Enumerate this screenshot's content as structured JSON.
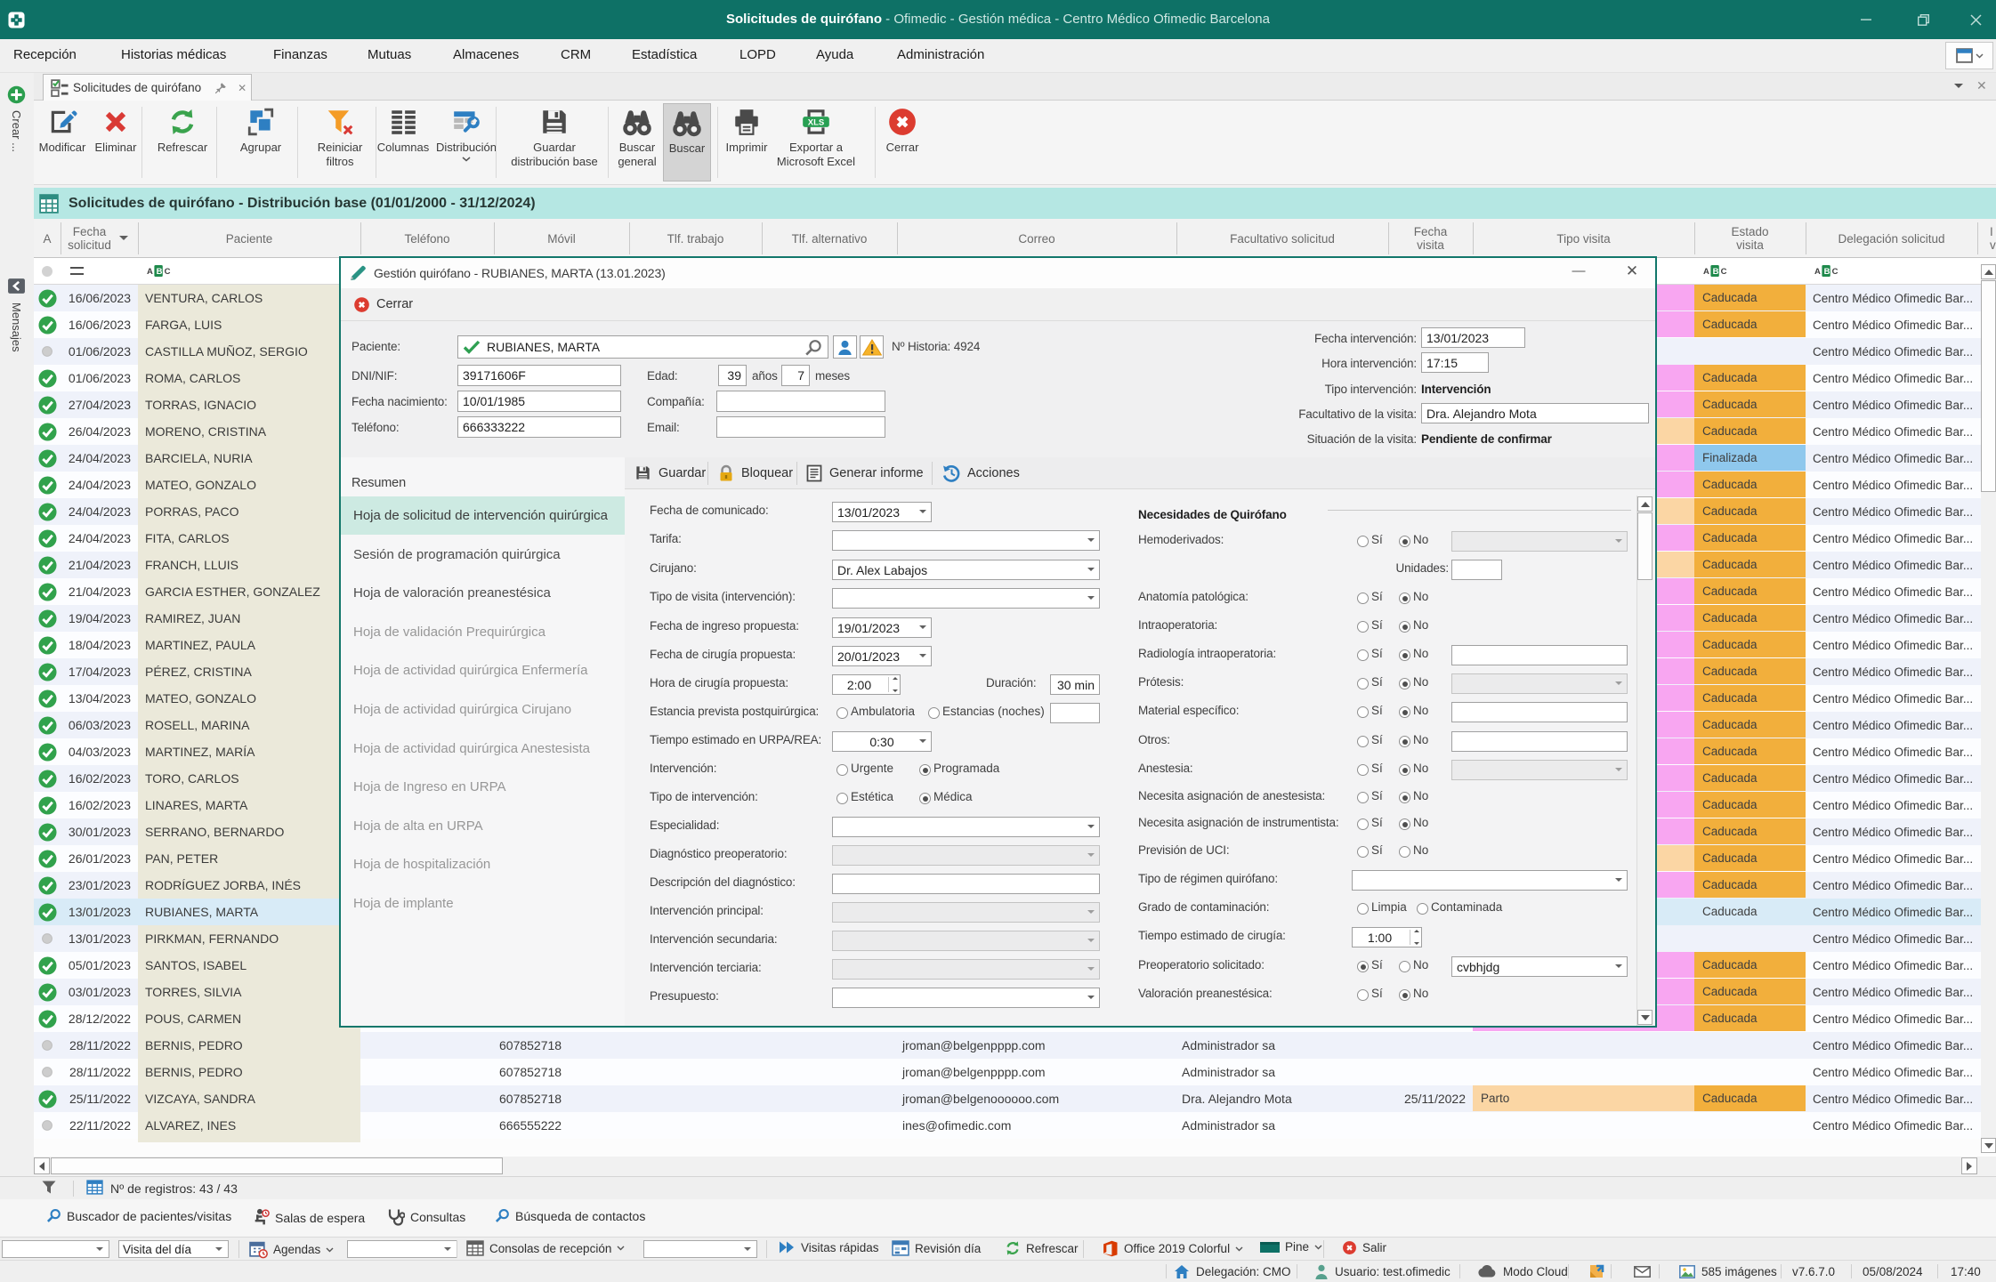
{
  "window": {
    "title": "Solicitudes de quirófano",
    "title_suffix": " - Ofimedic - Gestión médica - Centro Médico Ofimedic Barcelona"
  },
  "menu": {
    "items": [
      "Recepción",
      "Historias médicas",
      "Finanzas",
      "Mutuas",
      "Almacenes",
      "CRM",
      "Estadística",
      "LOPD",
      "Ayuda",
      "Administración"
    ]
  },
  "tab": {
    "label": "Solicitudes de quirófano"
  },
  "toolbar": {
    "buttons": [
      {
        "label1": "Modificar",
        "label2": ""
      },
      {
        "label1": "Eliminar",
        "label2": ""
      },
      {
        "label1": "Refrescar",
        "label2": ""
      },
      {
        "label1": "Agrupar",
        "label2": ""
      },
      {
        "label1": "Reiniciar",
        "label2": "filtros"
      },
      {
        "label1": "Columnas",
        "label2": ""
      },
      {
        "label1": "Distribución",
        "label2": ""
      },
      {
        "label1": "Guardar",
        "label2": "distribución base"
      },
      {
        "label1": "Buscar",
        "label2": "general"
      },
      {
        "label1": "Buscar",
        "label2": ""
      },
      {
        "label1": "Imprimir",
        "label2": ""
      },
      {
        "label1": "Exportar a",
        "label2": "Microsoft Excel"
      },
      {
        "label1": "Cerrar",
        "label2": ""
      }
    ]
  },
  "sidebar": {
    "crear": "Crear ...",
    "mensajes": "Mensajes"
  },
  "infoband": {
    "title": "Solicitudes de quirófano - Distribución base (01/01/2000 - 31/12/2024)"
  },
  "table": {
    "columns": [
      "A",
      "Fecha solicitud",
      "Paciente",
      "Teléfono",
      "Móvil",
      "Tlf. trabajo",
      "Tlf. alternativo",
      "Correo",
      "Facultativo solicitud",
      "Fecha visita",
      "Tipo visita",
      "Estado visita",
      "Delegación solicitud"
    ],
    "rows": [
      {
        "fecha": "16/06/2023",
        "paciente": "VENTURA, CARLOS",
        "estado": "Caducada",
        "delegacion": "Centro Médico Ofimedic Bar...",
        "status": "check",
        "tipo_color": "pink"
      },
      {
        "fecha": "16/06/2023",
        "paciente": "FARGA, LUIS",
        "estado": "Caducada",
        "delegacion": "Centro Médico Ofimedic Bar...",
        "status": "check",
        "tipo_color": "pink"
      },
      {
        "fecha": "01/06/2023",
        "paciente": "CASTILLA MUÑOZ, SERGIO",
        "estado": "",
        "delegacion": "Centro Médico Ofimedic Bar...",
        "status": "dot",
        "tipo_color": ""
      },
      {
        "fecha": "01/06/2023",
        "paciente": "ROMA, CARLOS",
        "estado": "Caducada",
        "delegacion": "Centro Médico Ofimedic Bar...",
        "status": "check",
        "tipo_color": "pink"
      },
      {
        "fecha": "27/04/2023",
        "paciente": "TORRAS, IGNACIO",
        "estado": "Caducada",
        "delegacion": "Centro Médico Ofimedic Bar...",
        "status": "check",
        "tipo_color": "pink"
      },
      {
        "fecha": "26/04/2023",
        "paciente": "MORENO, CRISTINA",
        "estado": "Caducada",
        "delegacion": "Centro Médico Ofimedic Bar...",
        "status": "check",
        "tipo_color": "orange"
      },
      {
        "fecha": "24/04/2023",
        "paciente": "BARCIELA, NURIA",
        "estado": "Finalizada",
        "delegacion": "Centro Médico Ofimedic Bar...",
        "status": "check",
        "tipo_color": "pink"
      },
      {
        "fecha": "24/04/2023",
        "paciente": "MATEO, GONZALO",
        "estado": "Caducada",
        "delegacion": "Centro Médico Ofimedic Bar...",
        "status": "check",
        "tipo_color": "pink"
      },
      {
        "fecha": "24/04/2023",
        "paciente": "PORRAS, PACO",
        "estado": "Caducada",
        "delegacion": "Centro Médico Ofimedic Bar...",
        "status": "check",
        "tipo_color": "orange"
      },
      {
        "fecha": "24/04/2023",
        "paciente": "FITA, CARLOS",
        "estado": "Caducada",
        "delegacion": "Centro Médico Ofimedic Bar...",
        "status": "check",
        "tipo_color": "pink"
      },
      {
        "fecha": "21/04/2023",
        "paciente": "FRANCH, LLUIS",
        "estado": "Caducada",
        "delegacion": "Centro Médico Ofimedic Bar...",
        "status": "check",
        "tipo_color": "orange"
      },
      {
        "fecha": "21/04/2023",
        "paciente": "GARCIA ESTHER, GONZALEZ",
        "estado": "Caducada",
        "delegacion": "Centro Médico Ofimedic Bar...",
        "status": "check",
        "tipo_color": "pink"
      },
      {
        "fecha": "19/04/2023",
        "paciente": "RAMIREZ, JUAN",
        "estado": "Caducada",
        "delegacion": "Centro Médico Ofimedic Bar...",
        "status": "check",
        "tipo_color": "pink"
      },
      {
        "fecha": "18/04/2023",
        "paciente": "MARTINEZ, PAULA",
        "estado": "Caducada",
        "delegacion": "Centro Médico Ofimedic Bar...",
        "status": "check",
        "tipo_color": "pink"
      },
      {
        "fecha": "17/04/2023",
        "paciente": "PÉREZ, CRISTINA",
        "estado": "Caducada",
        "delegacion": "Centro Médico Ofimedic Bar...",
        "status": "check",
        "tipo_color": "pink"
      },
      {
        "fecha": "13/04/2023",
        "paciente": "MATEO, GONZALO",
        "estado": "Caducada",
        "delegacion": "Centro Médico Ofimedic Bar...",
        "status": "check",
        "tipo_color": "pink"
      },
      {
        "fecha": "06/03/2023",
        "paciente": "ROSELL, MARINA",
        "estado": "Caducada",
        "delegacion": "Centro Médico Ofimedic Bar...",
        "status": "check",
        "tipo_color": "pink"
      },
      {
        "fecha": "04/03/2023",
        "paciente": "MARTINEZ, MARÍA",
        "estado": "Caducada",
        "delegacion": "Centro Médico Ofimedic Bar...",
        "status": "check",
        "tipo_color": "pink"
      },
      {
        "fecha": "16/02/2023",
        "paciente": "TORO, CARLOS",
        "estado": "Caducada",
        "delegacion": "Centro Médico Ofimedic Bar...",
        "status": "check",
        "tipo_color": "pink"
      },
      {
        "fecha": "16/02/2023",
        "paciente": "LINARES, MARTA",
        "estado": "Caducada",
        "delegacion": "Centro Médico Ofimedic Bar...",
        "status": "check",
        "tipo_color": "pink"
      },
      {
        "fecha": "30/01/2023",
        "paciente": "SERRANO, BERNARDO",
        "estado": "Caducada",
        "delegacion": "Centro Médico Ofimedic Bar...",
        "status": "check",
        "tipo_color": "pink"
      },
      {
        "fecha": "26/01/2023",
        "paciente": "PAN, PETER",
        "estado": "Caducada",
        "delegacion": "Centro Médico Ofimedic Bar...",
        "status": "check",
        "tipo_color": "orange"
      },
      {
        "fecha": "23/01/2023",
        "paciente": "RODRÍGUEZ JORBA, INÉS",
        "estado": "Caducada",
        "delegacion": "Centro Médico Ofimedic Bar...",
        "status": "check",
        "tipo_color": "pink"
      },
      {
        "fecha": "13/01/2023",
        "paciente": "RUBIANES, MARTA",
        "estado": "Caducada",
        "delegacion": "Centro Médico Ofimedic Bar...",
        "status": "check",
        "tipo_color": "",
        "selected": true
      },
      {
        "fecha": "13/01/2023",
        "paciente": "PIRKMAN, FERNANDO",
        "estado": "",
        "delegacion": "Centro Médico Ofimedic Bar...",
        "status": "dot",
        "tipo_color": ""
      },
      {
        "fecha": "05/01/2023",
        "paciente": "SANTOS, ISABEL",
        "estado": "Caducada",
        "delegacion": "Centro Médico Ofimedic Bar...",
        "status": "check",
        "tipo_color": "pink"
      },
      {
        "fecha": "03/01/2023",
        "paciente": "TORRES, SILVIA",
        "estado": "Caducada",
        "delegacion": "Centro Médico Ofimedic Bar...",
        "status": "check",
        "tipo_color": "pink"
      },
      {
        "fecha": "28/12/2022",
        "paciente": "POUS, CARMEN",
        "estado": "Caducada",
        "delegacion": "Centro Médico Ofimedic Bar...",
        "status": "check",
        "tipo_color": "pink"
      },
      {
        "fecha": "28/11/2022",
        "paciente": "BERNIS, PEDRO",
        "movil": "607852718",
        "correo": "jroman@belgenpppp.com",
        "facultativo": "Administrador sa",
        "estado": "",
        "delegacion": "Centro Médico Ofimedic Bar...",
        "status": "dot",
        "tipo_color": ""
      },
      {
        "fecha": "28/11/2022",
        "paciente": "BERNIS, PEDRO",
        "movil": "607852718",
        "correo": "jroman@belgenpppp.com",
        "facultativo": "Administrador sa",
        "estado": "",
        "delegacion": "Centro Médico Ofimedic Bar...",
        "status": "dot",
        "tipo_color": ""
      },
      {
        "fecha": "25/11/2022",
        "paciente": "VIZCAYA, SANDRA",
        "movil": "607852718",
        "correo": "jroman@belgenoooooo.com",
        "facultativo": "Dra. Alejandro Mota",
        "fecha_visita": "25/11/2022",
        "tipo": "Parto",
        "estado": "Caducada",
        "delegacion": "Centro Médico Ofimedic Bar...",
        "status": "check",
        "tipo_color": "orange"
      },
      {
        "fecha": "22/11/2022",
        "paciente": "ALVAREZ, INES",
        "movil": "666555222",
        "correo": "ines@ofimedic.com",
        "facultativo": "Administrador sa",
        "estado": "",
        "delegacion": "Centro Médico Ofimedic Bar...",
        "status": "dot",
        "tipo_color": ""
      }
    ],
    "row_colors": {
      "pink": "#f8a6f1",
      "orange": "#fbd6a4",
      "caducada": "#f2af3c",
      "finalizada": "#8fc8ed",
      "selected": "#d8ebf7",
      "beige": "#ebe9da",
      "tint": "#eff2fa",
      "white": "#fcfdff"
    }
  },
  "dialog": {
    "title": "Gestión quirófano - RUBIANES, MARTA (13.01.2023)",
    "close_label": "Cerrar",
    "si": "Sí",
    "no": "No",
    "patient": {
      "paciente_label": "Paciente:",
      "paciente": "RUBIANES, MARTA",
      "historia_label": "Nº Historia: 4924",
      "dni_label": "DNI/NIF:",
      "dni": "39171606F",
      "edad_label": "Edad:",
      "edad": "39",
      "anos_label": "años",
      "meses": "7",
      "meses_label": "meses",
      "fnac_label": "Fecha nacimiento:",
      "fnac": "10/01/1985",
      "compania_label": "Compañía:",
      "telefono_label": "Teléfono:",
      "telefono": "666333222",
      "email_label": "Email:",
      "fecha_int_label": "Fecha intervención:",
      "fecha_int": "13/01/2023",
      "hora_int_label": "Hora intervención:",
      "hora_int": "17:15",
      "tipo_int_label": "Tipo intervención:",
      "tipo_int": "Intervención",
      "facultativo_label": "Facultativo de la visita:",
      "facultativo": "Dra. Alejandro Mota",
      "situacion_label": "Situación de la visita:",
      "situacion": "Pendiente de confirmar"
    },
    "actions": [
      "Guardar",
      "Bloquear",
      "Generar informe",
      "Acciones"
    ],
    "resumen": "Resumen",
    "nav": [
      "Hoja de solicitud de intervención quirúrgica",
      "Sesión de programación quirúrgica",
      "Hoja de valoración preanestésica",
      "Hoja de validación Prequirúrgica",
      "Hoja de actividad quirúrgica Enfermería",
      "Hoja de actividad quirúrgica Cirujano",
      "Hoja de actividad quirúrgica Anestesista",
      "Hoja de Ingreso en URPA",
      "Hoja de alta en URPA",
      "Hoja de hospitalización",
      "Hoja de implante"
    ],
    "form_left": [
      {
        "label": "Fecha de comunicado:",
        "value": "13/01/2023"
      },
      {
        "label": "Tarifa:",
        "value": ""
      },
      {
        "label": "Cirujano:",
        "value": "Dr. Alex Labajos"
      },
      {
        "label": "Tipo de visita (intervención):",
        "value": ""
      },
      {
        "label": "Fecha de ingreso propuesta:",
        "value": "19/01/2023"
      },
      {
        "label": "Fecha de cirugía propuesta:",
        "value": "20/01/2023"
      },
      {
        "label": "Hora de cirugía propuesta:",
        "value": "2:00",
        "extra_label": "Duración:",
        "extra_value": "30 min"
      },
      {
        "label": "Estancia prevista postquirúrgica:",
        "options": [
          "Ambulatoria",
          "Estancias (noches)"
        ]
      },
      {
        "label": "Tiempo estimado en URPA/REA:",
        "value": "0:30"
      },
      {
        "label": "Intervención:",
        "options": [
          "Urgente",
          "Programada"
        ]
      },
      {
        "label": "Tipo de intervención:",
        "options": [
          "Estética",
          "Médica"
        ]
      },
      {
        "label": "Especialidad:",
        "value": ""
      },
      {
        "label": "Diagnóstico preoperatorio:",
        "value": ""
      },
      {
        "label": "Descripción del diagnóstico:",
        "value": ""
      },
      {
        "label": "Intervención principal:",
        "value": ""
      },
      {
        "label": "Intervención secundaria:",
        "value": ""
      },
      {
        "label": "Intervención terciaria:",
        "value": ""
      },
      {
        "label": "Presupuesto:",
        "value": ""
      }
    ],
    "right_title": "Necesidades de Quirófano",
    "form_right": [
      {
        "label": "Hemoderivados:"
      },
      {
        "label": "Unidades:"
      },
      {
        "label": "Anatomía patológica:"
      },
      {
        "label": "Intraoperatoria:"
      },
      {
        "label": "Radiología intraoperatoria:"
      },
      {
        "label": "Prótesis:"
      },
      {
        "label": "Material específico:"
      },
      {
        "label": "Otros:"
      },
      {
        "label": "Anestesia:"
      },
      {
        "label": "Necesita asignación de anestesista:"
      },
      {
        "label": "Necesita asignación de instrumentista:"
      },
      {
        "label": "Previsión de UCI:"
      },
      {
        "label": "Tipo de régimen quirófano:",
        "value": ""
      },
      {
        "label": "Grado de contaminación:",
        "options": [
          "Limpia",
          "Contaminada"
        ]
      },
      {
        "label": "Tiempo estimado de cirugía:",
        "value": "1:00"
      },
      {
        "label": "Preoperatorio solicitado:",
        "value": "cvbhjdg"
      },
      {
        "label": "Valoración preanestésica:"
      }
    ]
  },
  "bottombar": {
    "registros": "Nº de registros: 43 / 43",
    "shortcuts": [
      "Buscador de pacientes/visitas",
      "Salas de espera",
      "Consultas",
      "Búsqueda de contactos"
    ],
    "visita_combo": "Visita del día",
    "agendas": "Agendas",
    "consolas": "Consolas de recepción",
    "visitas_rapidas": "Visitas rápidas",
    "revision": "Revisión día",
    "refrescar": "Refrescar",
    "office": "Office 2019 Colorful",
    "pine": "Pine",
    "salir": "Salir"
  },
  "statusbar": {
    "delegacion": "Delegación:  CMO",
    "usuario": "Usuario: test.ofimedic",
    "modo": "Modo Cloud",
    "imagenes": "585 imágenes",
    "version": "v7.6.7.0",
    "fecha": "05/08/2024",
    "hora": "17:40"
  }
}
